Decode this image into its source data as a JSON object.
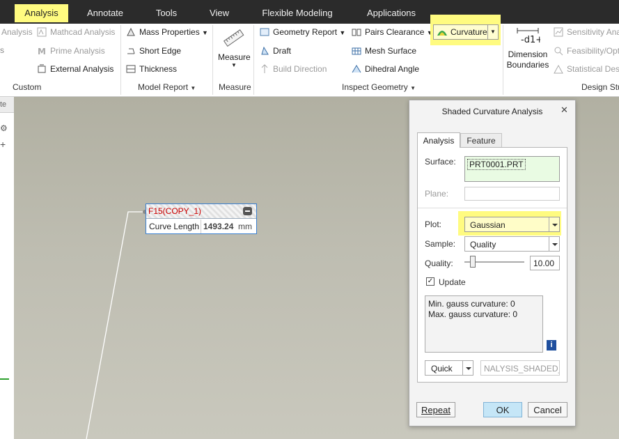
{
  "tabs": [
    {
      "label": "Analysis",
      "active": true
    },
    {
      "label": "Annotate",
      "active": false
    },
    {
      "label": "Tools",
      "active": false
    },
    {
      "label": "View",
      "active": false
    },
    {
      "label": "Flexible Modeling",
      "active": false
    },
    {
      "label": "Applications",
      "active": false
    }
  ],
  "ribbon": {
    "custom": {
      "items": [
        "Analysis",
        "Mathcad Analysis",
        "Prime Analysis",
        "External Analysis"
      ],
      "group_label": "Custom"
    },
    "model_report": {
      "items": [
        "Mass Properties",
        "Short Edge",
        "Thickness"
      ],
      "group_label": "Model Report"
    },
    "measure": {
      "button_label": "Measure",
      "group_label": "Measure"
    },
    "inspect_geometry": {
      "items": [
        "Geometry Report",
        "Draft",
        "Build Direction",
        "Pairs Clearance",
        "Mesh Surface",
        "Dihedral Angle",
        "Curvature"
      ],
      "group_label": "Inspect Geometry"
    },
    "design_study": {
      "dimension_boundaries": [
        "Dimension",
        "Boundaries"
      ],
      "items": [
        "Sensitivity Ana",
        "Feasibility/Opt",
        "Statistical Desi"
      ],
      "group_label": "Design Stu"
    }
  },
  "left_panel": {
    "label": "te"
  },
  "feature_note": {
    "name": "F15(COPY_1)",
    "label": "Curve Length",
    "value": "1493.24",
    "unit": "mm"
  },
  "dialog": {
    "title": "Shaded Curvature Analysis",
    "tabs": [
      "Analysis",
      "Feature"
    ],
    "surface_label": "Surface:",
    "surface_value": "PRT0001.PRT",
    "plane_label": "Plane:",
    "plot_label": "Plot:",
    "plot_value": "Gaussian",
    "sample_label": "Sample:",
    "sample_value": "Quality",
    "quality_label": "Quality:",
    "quality_value": "10.00",
    "update_label": "Update",
    "results": [
      "Min. gauss curvature: 0",
      "Max. gauss curvature: 0"
    ],
    "quick_label": "Quick",
    "name_value": "NALYSIS_SHADED_1",
    "repeat_label": "Repeat",
    "ok_label": "OK",
    "cancel_label": "Cancel"
  },
  "colors": {
    "highlight": "#fffb80",
    "accent": "#1a5fb4",
    "note_red": "#cc0000",
    "ok_button": "#c5e6f7"
  }
}
